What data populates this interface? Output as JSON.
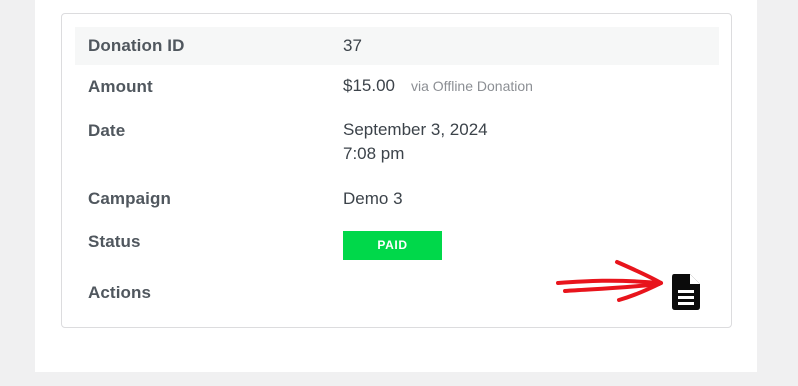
{
  "donation_details": {
    "donation_id": {
      "label": "Donation ID",
      "value": "37"
    },
    "amount": {
      "label": "Amount",
      "value": "$15.00",
      "method": "via Offline Donation"
    },
    "date": {
      "label": "Date",
      "date": "September 3, 2024",
      "time": "7:08 pm"
    },
    "campaign": {
      "label": "Campaign",
      "value": "Demo 3"
    },
    "status": {
      "label": "Status",
      "value": "PAID",
      "color": "#00d84a"
    },
    "actions": {
      "label": "Actions",
      "icon": "receipt-document-icon"
    }
  },
  "annotation": {
    "arrow_color": "#e8141c"
  }
}
